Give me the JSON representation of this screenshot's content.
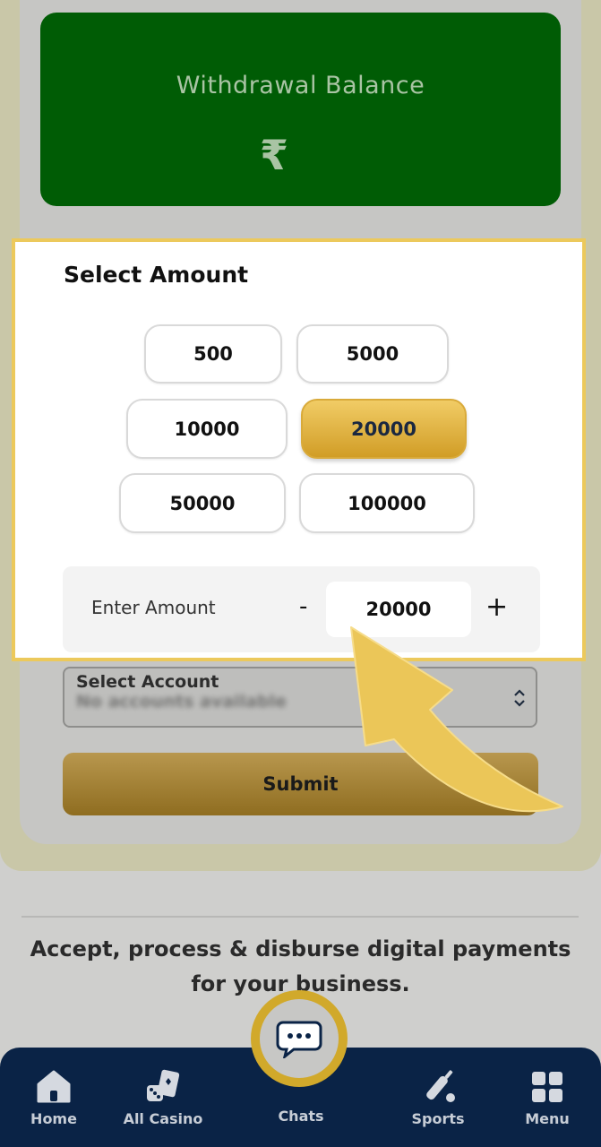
{
  "balance": {
    "title": "Withdrawal Balance",
    "currency_symbol": "₹"
  },
  "select_amount": {
    "title": "Select Amount",
    "presets": [
      "500",
      "5000",
      "10000",
      "20000",
      "50000",
      "100000"
    ],
    "selected": "20000",
    "enter_label": "Enter Amount",
    "minus": "-",
    "plus": "+",
    "value": "20000"
  },
  "account": {
    "label": "Select Account",
    "value": "No accounts available"
  },
  "submit_label": "Submit",
  "tagline": "Accept, process & disburse digital payments for your business.",
  "nav": {
    "home": "Home",
    "casino": "All Casino",
    "chats": "Chats",
    "sports": "Sports",
    "menu": "Menu"
  },
  "colors": {
    "highlight": "#ecc95c",
    "balance_card": "#005c05",
    "nav_bg": "#0a2346",
    "accent_gold": "#d19d26"
  }
}
